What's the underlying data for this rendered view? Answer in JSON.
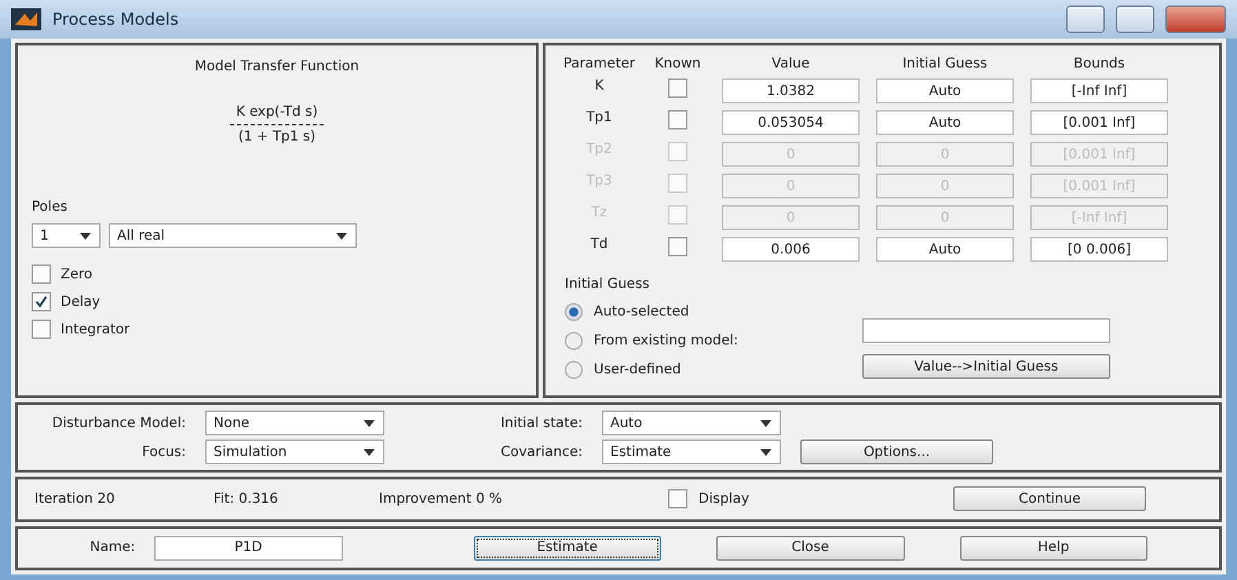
{
  "window": {
    "title": "Process Models"
  },
  "transfer_function": {
    "title": "Model Transfer Function",
    "numerator": "K exp(-Td s)",
    "denominator": "(1 + Tp1 s)"
  },
  "poles": {
    "label": "Poles",
    "count": "1",
    "type": "All real"
  },
  "options": [
    {
      "label": "Zero",
      "checked": false
    },
    {
      "label": "Delay",
      "checked": true
    },
    {
      "label": "Integrator",
      "checked": false
    }
  ],
  "parameters": {
    "columns": [
      "Parameter",
      "Known",
      "Value",
      "Initial Guess",
      "Bounds"
    ],
    "rows": [
      {
        "name": "K",
        "disabled": false,
        "known": false,
        "value": "1.0382",
        "initial_guess": "Auto",
        "bounds": "[-Inf Inf]"
      },
      {
        "name": "Tp1",
        "disabled": false,
        "known": false,
        "value": "0.053054",
        "initial_guess": "Auto",
        "bounds": "[0.001 Inf]"
      },
      {
        "name": "Tp2",
        "disabled": true,
        "known": false,
        "value": "0",
        "initial_guess": "0",
        "bounds": "[0.001 Inf]"
      },
      {
        "name": "Tp3",
        "disabled": true,
        "known": false,
        "value": "0",
        "initial_guess": "0",
        "bounds": "[0.001 Inf]"
      },
      {
        "name": "Tz",
        "disabled": true,
        "known": false,
        "value": "0",
        "initial_guess": "0",
        "bounds": "[-Inf Inf]"
      },
      {
        "name": "Td",
        "disabled": false,
        "known": false,
        "value": "0.006",
        "initial_guess": "Auto",
        "bounds": "[0 0.006]"
      }
    ]
  },
  "initial_guess": {
    "label": "Initial Guess",
    "choices": [
      {
        "label": "Auto-selected",
        "selected": true
      },
      {
        "label": "From existing model:",
        "selected": false
      },
      {
        "label": "User-defined",
        "selected": false
      }
    ],
    "button": "Value-->Initial Guess"
  },
  "disturbance": {
    "disturbance_label": "Disturbance Model:",
    "disturbance_value": "None",
    "focus_label": "Focus:",
    "focus_value": "Simulation",
    "initial_state_label": "Initial state:",
    "initial_state_value": "Auto",
    "covariance_label": "Covariance:",
    "covariance_value": "Estimate",
    "options_button": "Options..."
  },
  "status": {
    "iteration": "Iteration 20",
    "fit": "Fit: 0.316",
    "improvement": "Improvement 0 %",
    "display": {
      "label": "Display",
      "checked": false
    },
    "continue_button": "Continue"
  },
  "footer": {
    "name_label": "Name:",
    "name_value": "P1D",
    "buttons": [
      "Estimate",
      "Close",
      "Help"
    ]
  }
}
